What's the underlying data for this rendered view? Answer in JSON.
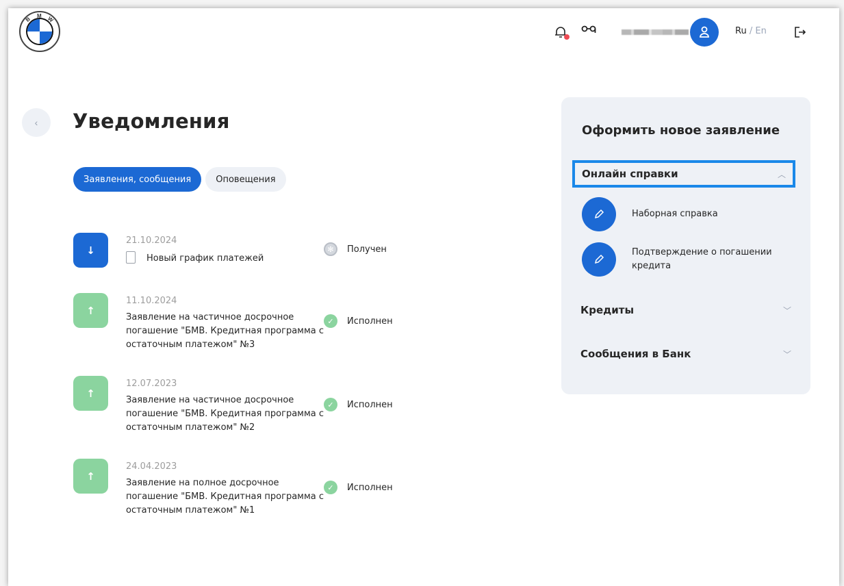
{
  "header": {
    "logo_letters": [
      "B",
      "M",
      "W"
    ],
    "lang": {
      "active": "Ru",
      "separator": "/",
      "inactive": "En"
    },
    "icons": {
      "bell": "bell-icon",
      "glasses": "glasses-icon",
      "avatar": "user-icon",
      "logout": "logout-icon"
    },
    "accent_color": "#1c69d4",
    "alert_dot_color": "#ee4b54"
  },
  "page": {
    "back": "‹",
    "title": "Уведомления",
    "tabs": [
      {
        "label": "Заявления, сообщения",
        "active": true
      },
      {
        "label": "Оповещения",
        "active": false
      }
    ]
  },
  "notifications": [
    {
      "direction": "down",
      "arrow": "↓",
      "date": "21.10.2024",
      "text": "Новый график платежей",
      "status": "Получен",
      "status_type": "received"
    },
    {
      "direction": "up",
      "arrow": "↑",
      "date": "11.10.2024",
      "text": "Заявление на частичное досрочное погашение \"БМВ. Кредитная программа с остаточным платежом\" №3",
      "status": "Исполнен",
      "status_type": "done"
    },
    {
      "direction": "up",
      "arrow": "↑",
      "date": "12.07.2023",
      "text": "Заявление на частичное досрочное погашение \"БМВ. Кредитная программа с остаточным платежом\" №2",
      "status": "Исполнен",
      "status_type": "done"
    },
    {
      "direction": "up",
      "arrow": "↑",
      "date": "24.04.2023",
      "text": "Заявление на полное досрочное погашение \"БМВ. Кредитная программа с остаточным платежом\" №1",
      "status": "Исполнен",
      "status_type": "done"
    }
  ],
  "panel": {
    "title": "Оформить новое заявление",
    "sections": [
      {
        "label": "Онлайн справки",
        "expanded": true,
        "chevron": "︿",
        "items": [
          {
            "label": "Наборная справка"
          },
          {
            "label": "Подтверждение о погашении кредита"
          }
        ]
      },
      {
        "label": "Кредиты",
        "expanded": false,
        "chevron": "﹀"
      },
      {
        "label": "Сообщения в Банк",
        "expanded": false,
        "chevron": "﹀"
      }
    ]
  }
}
